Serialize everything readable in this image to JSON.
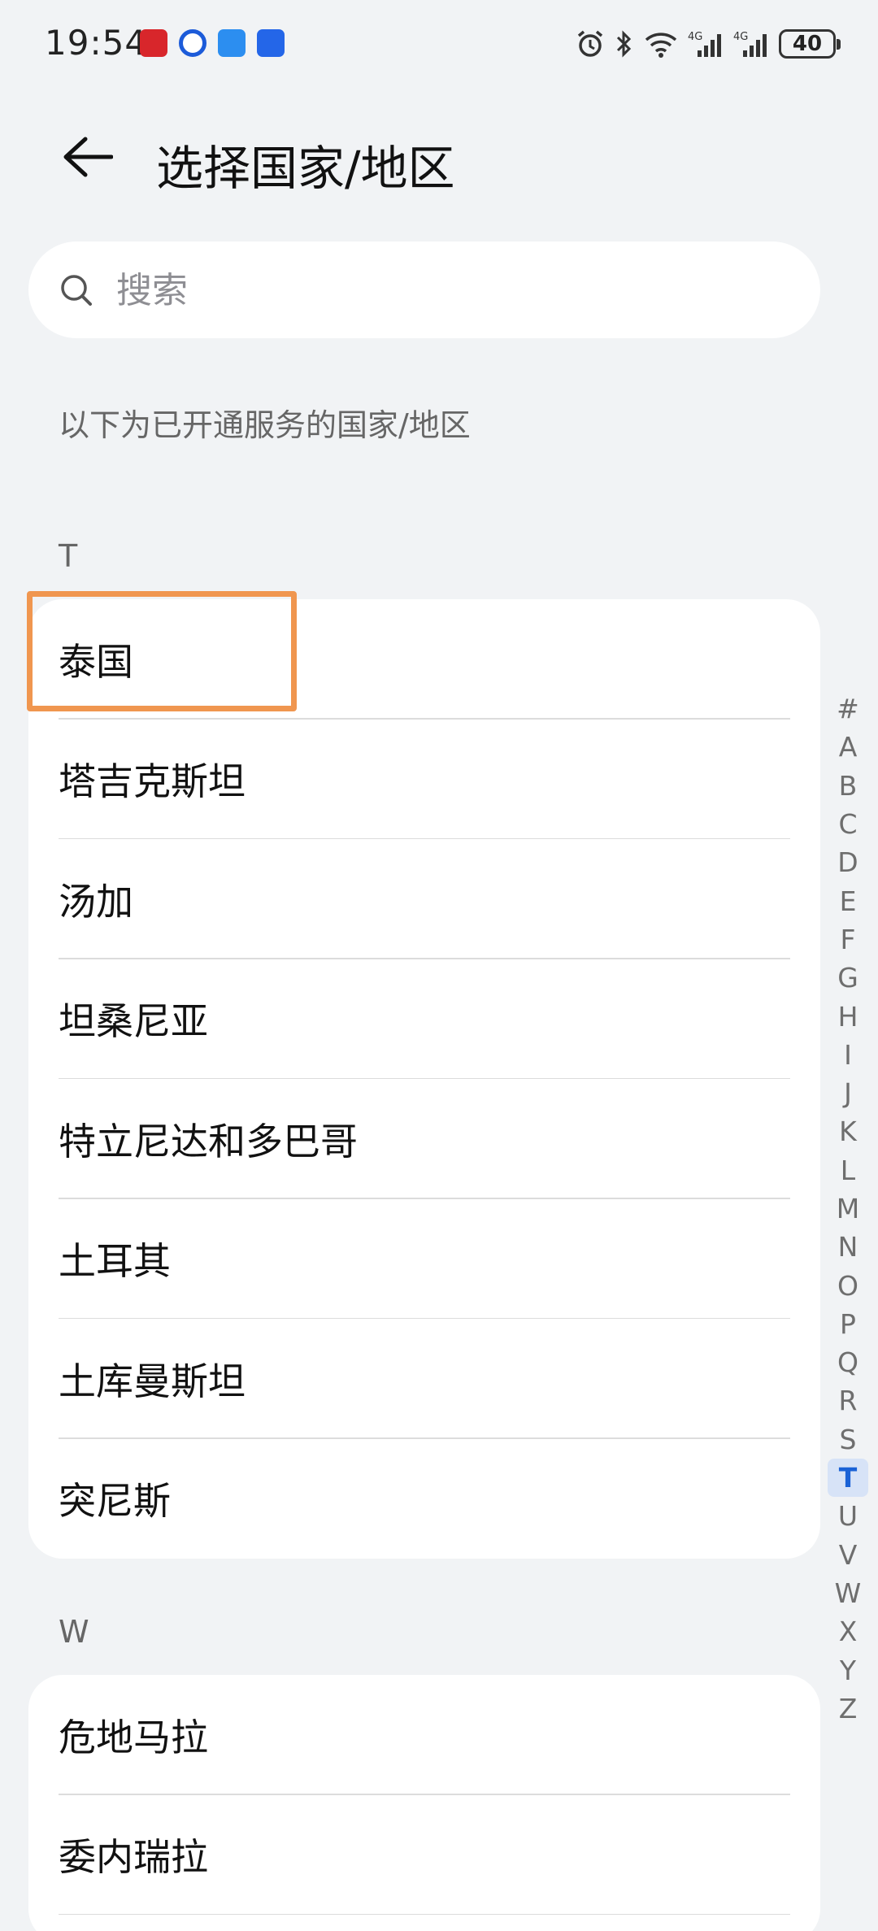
{
  "status_bar": {
    "time": "19:54",
    "battery": "40"
  },
  "header": {
    "title": "选择国家/地区"
  },
  "search": {
    "placeholder": "搜索"
  },
  "info_text": "以下为已开通服务的国家/地区",
  "sections": [
    {
      "letter": "T",
      "items": [
        "泰国",
        "塔吉克斯坦",
        "汤加",
        "坦桑尼亚",
        "特立尼达和多巴哥",
        "土耳其",
        "土库曼斯坦",
        "突尼斯"
      ]
    },
    {
      "letter": "W",
      "items": [
        "危地马拉",
        "委内瑞拉"
      ]
    }
  ],
  "index_bar": {
    "letters": [
      "#",
      "A",
      "B",
      "C",
      "D",
      "E",
      "F",
      "G",
      "H",
      "I",
      "J",
      "K",
      "L",
      "M",
      "N",
      "O",
      "P",
      "Q",
      "R",
      "S",
      "T",
      "U",
      "V",
      "W",
      "X",
      "Y",
      "Z"
    ],
    "active": "T"
  },
  "colors": {
    "highlight": "#f0964f",
    "active_index": "#1a62d6",
    "background": "#f1f3f5"
  }
}
